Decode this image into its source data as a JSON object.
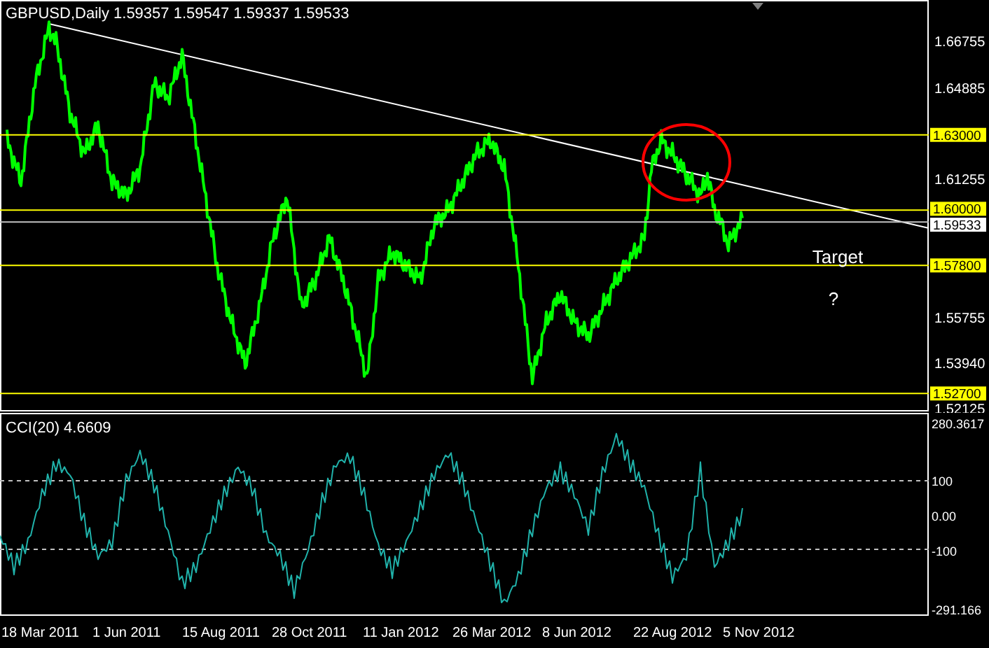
{
  "price_panel": {
    "symbol": "GBPUSD,Daily",
    "quote": [
      "1.59357",
      "1.59547",
      "1.59337",
      "1.59533"
    ],
    "axis_labels": [
      "1.66755",
      "1.64885",
      "1.61255",
      "1.55755",
      "1.53940",
      "1.52125"
    ],
    "price_tags": [
      {
        "label": "1.63000",
        "kind": "level"
      },
      {
        "label": "1.60000",
        "kind": "level"
      },
      {
        "label": "1.59533",
        "kind": "bid"
      },
      {
        "label": "1.57800",
        "kind": "level"
      },
      {
        "label": "1.52700",
        "kind": "level"
      }
    ],
    "notes": [
      "Target",
      "?"
    ]
  },
  "cci_panel": {
    "title": "CCI(20)",
    "reading": "4.6609",
    "axis_labels": [
      "280.3617",
      "100",
      "0.00",
      "-100",
      "-291.166"
    ]
  },
  "time_axis": [
    "18 Mar 2011",
    "1 Jun 2011",
    "15 Aug 2011",
    "28 Oct 2011",
    "11 Jan 2012",
    "26 Mar 2012",
    "8 Jun 2012",
    "22 Aug 2012",
    "5 Nov 2012"
  ]
}
